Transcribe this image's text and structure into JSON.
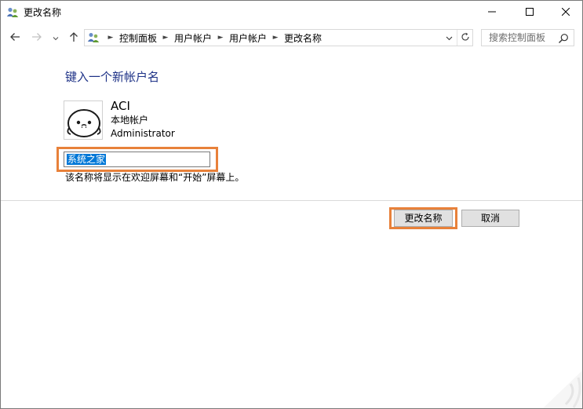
{
  "window": {
    "title": "更改名称"
  },
  "nav": {
    "breadcrumbs": [
      "控制面板",
      "用户帐户",
      "用户帐户",
      "更改名称"
    ],
    "search_placeholder": "搜索控制面板"
  },
  "content": {
    "heading": "键入一个新帐户名",
    "account": {
      "name": "ACI",
      "type": "本地帐户",
      "role": "Administrator"
    },
    "new_name_value": "系统之家",
    "hint": "该名称将显示在欢迎屏幕和“开始”屏幕上。"
  },
  "buttons": {
    "rename": "更改名称",
    "cancel": "取消"
  },
  "colors": {
    "heading": "#1e3287",
    "highlight": "#e8813a",
    "selection": "#0078d7"
  }
}
